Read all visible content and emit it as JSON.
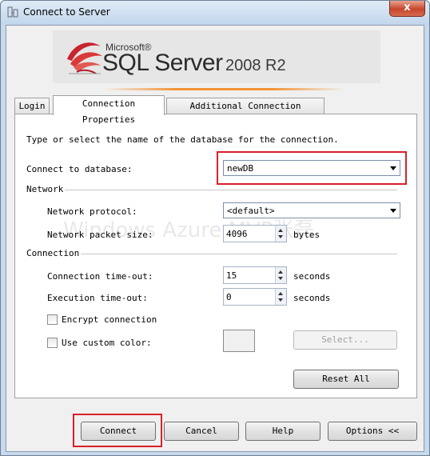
{
  "window": {
    "title": "Connect to Server",
    "close_label": "x"
  },
  "banner": {
    "microsoft": "Microsoft®",
    "product": "SQL Server",
    "version": "2008 R2"
  },
  "tabs": [
    {
      "label": "Login",
      "active": false
    },
    {
      "label": "Connection Properties",
      "active": true
    },
    {
      "label": "Additional Connection Parameters",
      "active": false
    }
  ],
  "form": {
    "instruction": "Type or select the name of the database for the connection.",
    "database_label": "Connect to database:",
    "database_value": "newDB",
    "network_group": "Network",
    "protocol_label": "Network protocol:",
    "protocol_value": "<default>",
    "packet_label": "Network packet size:",
    "packet_value": "4096",
    "packet_unit": "bytes",
    "connection_group": "Connection",
    "timeout_label": "Connection time-out:",
    "timeout_value": "15",
    "timeout_unit": "seconds",
    "exec_label": "Execution time-out:",
    "exec_value": "0",
    "exec_unit": "seconds",
    "encrypt_label": "Encrypt connection",
    "encrypt_checked": false,
    "custom_color_label": "Use custom color:",
    "custom_color_checked": false,
    "select_button": "Select...",
    "reset_button": "Reset All"
  },
  "watermark": "Windows Azure MVP张磊",
  "buttons": {
    "connect": "Connect",
    "cancel": "Cancel",
    "help": "Help",
    "options": "Options <<"
  },
  "colors": {
    "highlight": "#d8202b",
    "accent_orange": "#f29234"
  }
}
